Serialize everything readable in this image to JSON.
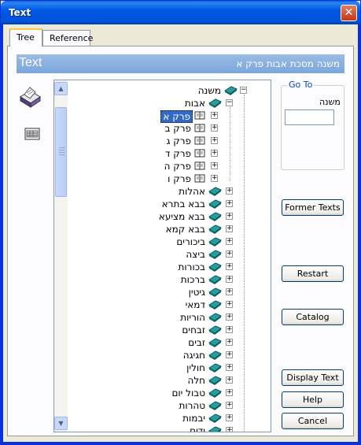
{
  "window": {
    "title": "Text",
    "close_symbol": "✕"
  },
  "tabs": [
    {
      "label": "Tree",
      "active": true
    },
    {
      "label": "Reference",
      "active": false
    }
  ],
  "header": {
    "left": "Text",
    "right": "משנה מסכת אבות פרק א"
  },
  "side_icons": [
    "printer-icon",
    "keyboard-icon"
  ],
  "tree": {
    "root": {
      "label": "משנה",
      "expanded": true
    },
    "children": [
      {
        "label": "אבות",
        "expanded": true,
        "children": [
          {
            "label": "פרק א",
            "selected": true
          },
          {
            "label": "פרק ב"
          },
          {
            "label": "פרק ג"
          },
          {
            "label": "פרק ד"
          },
          {
            "label": "פרק ה"
          },
          {
            "label": "פרק ו"
          }
        ]
      },
      {
        "label": "אהלות"
      },
      {
        "label": "בבא בתרא"
      },
      {
        "label": "בבא מציעא"
      },
      {
        "label": "בבא קמא"
      },
      {
        "label": "ביכורים"
      },
      {
        "label": "ביצה"
      },
      {
        "label": "בכורות"
      },
      {
        "label": "ברכות"
      },
      {
        "label": "גיטין"
      },
      {
        "label": "דמאי"
      },
      {
        "label": "הוריות"
      },
      {
        "label": "זבחים"
      },
      {
        "label": "זבים"
      },
      {
        "label": "חגיגה"
      },
      {
        "label": "חולין"
      },
      {
        "label": "חלה"
      },
      {
        "label": "טבול יום"
      },
      {
        "label": "טהרות"
      },
      {
        "label": "יבמות"
      },
      {
        "label": "ידים"
      }
    ]
  },
  "goto": {
    "legend": "Go To",
    "label": "משנה",
    "value": ""
  },
  "buttons": {
    "former_texts": "Former Texts",
    "restart": "Restart",
    "catalog": "Catalog",
    "display_text": "Display Text",
    "help": "Help",
    "cancel": "Cancel"
  },
  "colors": {
    "title_bar": "#0054e3",
    "header_bar": "#7aa6dc",
    "selection": "#316ac5",
    "book_icon": "#1f8a8a"
  }
}
